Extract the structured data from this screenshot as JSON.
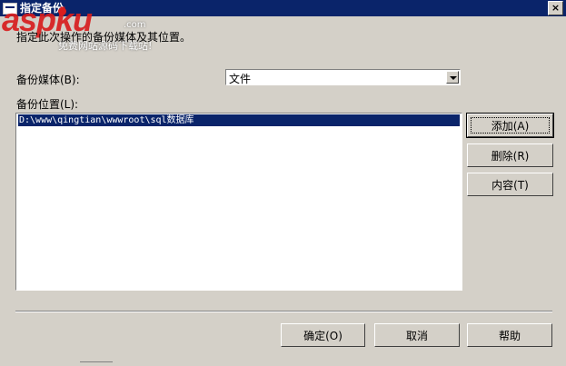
{
  "window": {
    "title": "指定备份",
    "close_glyph": "×"
  },
  "watermark": {
    "brand": "aspku",
    "com": ".com",
    "slogan": "免费网站源码下载站!"
  },
  "instruction": "指定此次操作的备份媒体及其位置。",
  "backup_media": {
    "label": "备份媒体(B):",
    "selected": "文件"
  },
  "backup_location": {
    "label": "备份位置(L):",
    "items": [
      "D:\\www\\qingtian\\wwwroot\\sql数据库"
    ]
  },
  "side_buttons": {
    "add": "添加(A)",
    "remove": "删除(R)",
    "contents": "内容(T)"
  },
  "footer_buttons": {
    "ok": "确定(O)",
    "cancel": "取消",
    "help": "帮助"
  }
}
